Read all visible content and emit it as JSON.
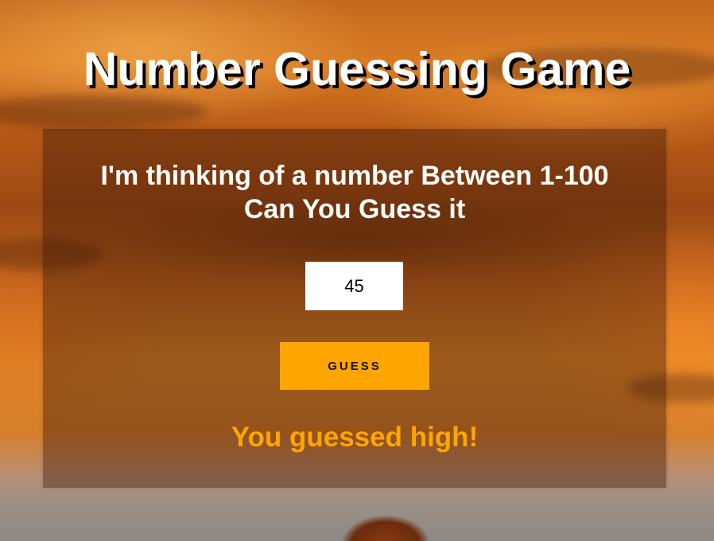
{
  "header": {
    "title": "Number Guessing Game"
  },
  "game": {
    "prompt_line1": "I'm thinking of a number Between 1-100",
    "prompt_line2": "Can You Guess it",
    "guess_value": "45",
    "guess_button_label": "GUESS",
    "result_message": "You guessed high!"
  },
  "colors": {
    "accent": "#ffa500",
    "title_text": "#ffffff",
    "title_shadow": "#000000"
  }
}
